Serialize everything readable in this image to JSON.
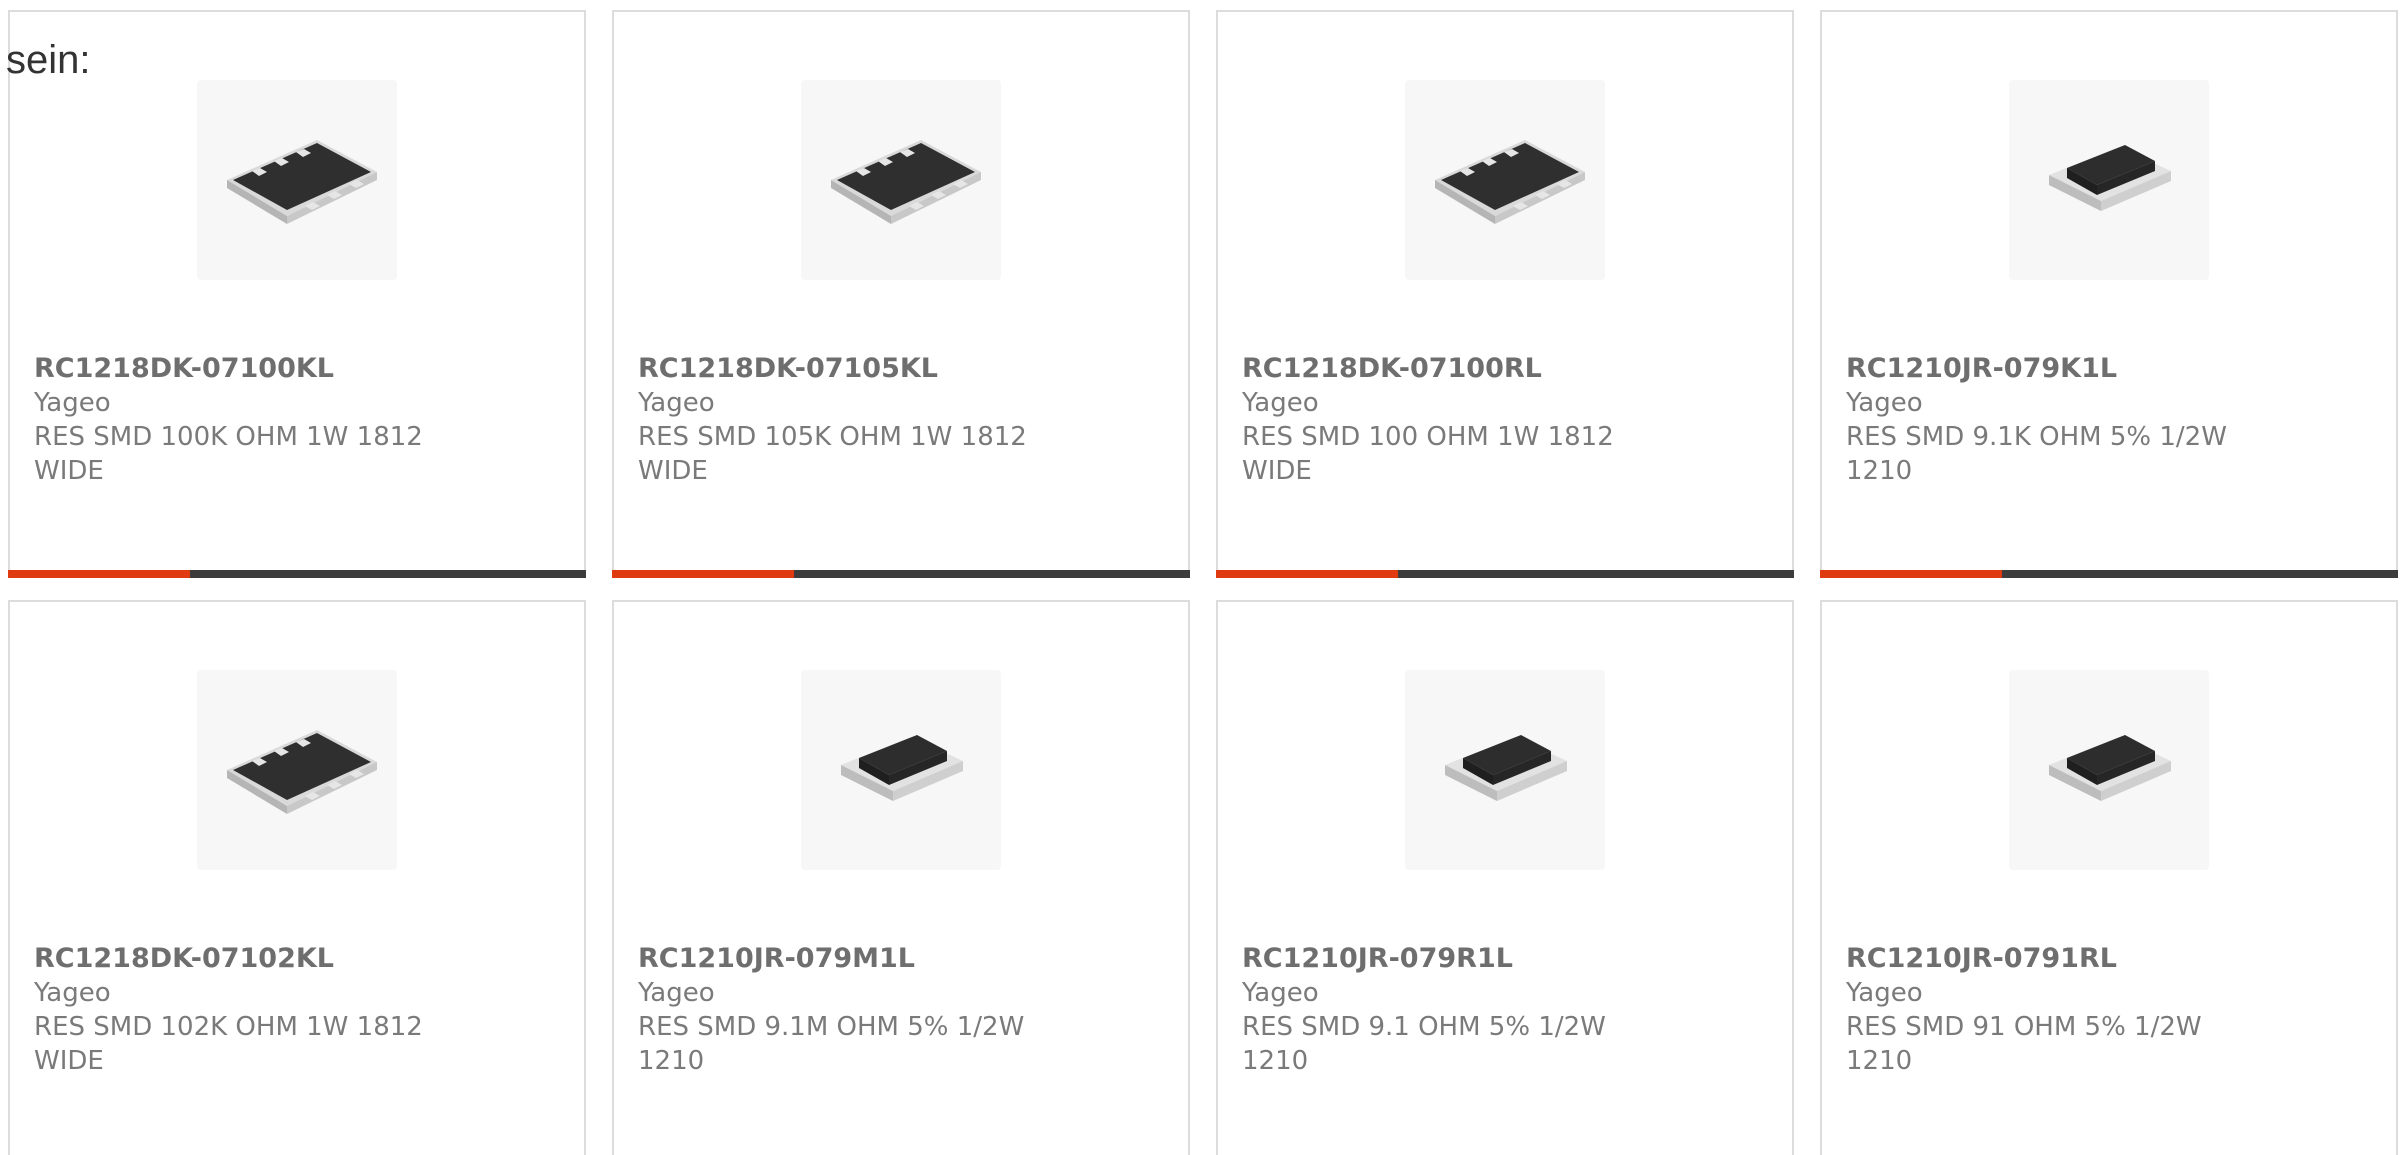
{
  "intro_text": "sein:",
  "colors": {
    "border": "#dcdcdc",
    "text": "#7a7a7a",
    "bar_dark": "#3c3c3c",
    "bar_accent": "#e03a10"
  },
  "products": [
    {
      "part_number": "RC1218DK-07100KL",
      "manufacturer": "Yageo",
      "description": "RES SMD 100K OHM 1W 1812 WIDE",
      "image": "resistor-array-icon",
      "hover_bar": true
    },
    {
      "part_number": "RC1218DK-07105KL",
      "manufacturer": "Yageo",
      "description": "RES SMD 105K OHM 1W 1812 WIDE",
      "image": "resistor-array-icon",
      "hover_bar": true
    },
    {
      "part_number": "RC1218DK-07100RL",
      "manufacturer": "Yageo",
      "description": "RES SMD 100 OHM 1W 1812 WIDE",
      "image": "resistor-array-icon",
      "hover_bar": true
    },
    {
      "part_number": "RC1210JR-079K1L",
      "manufacturer": "Yageo",
      "description": "RES SMD 9.1K OHM 5% 1/2W 1210",
      "image": "chip-resistor-icon",
      "hover_bar": true
    },
    {
      "part_number": "RC1218DK-07102KL",
      "manufacturer": "Yageo",
      "description": "RES SMD 102K OHM 1W 1812 WIDE",
      "image": "resistor-array-icon",
      "hover_bar": false
    },
    {
      "part_number": "RC1210JR-079M1L",
      "manufacturer": "Yageo",
      "description": "RES SMD 9.1M OHM 5% 1/2W 1210",
      "image": "chip-resistor-icon",
      "hover_bar": false
    },
    {
      "part_number": "RC1210JR-079R1L",
      "manufacturer": "Yageo",
      "description": "RES SMD 9.1 OHM 5% 1/2W 1210",
      "image": "chip-resistor-icon",
      "hover_bar": false
    },
    {
      "part_number": "RC1210JR-0791RL",
      "manufacturer": "Yageo",
      "description": "RES SMD 91 OHM 5% 1/2W 1210",
      "image": "chip-resistor-icon",
      "hover_bar": false
    }
  ]
}
